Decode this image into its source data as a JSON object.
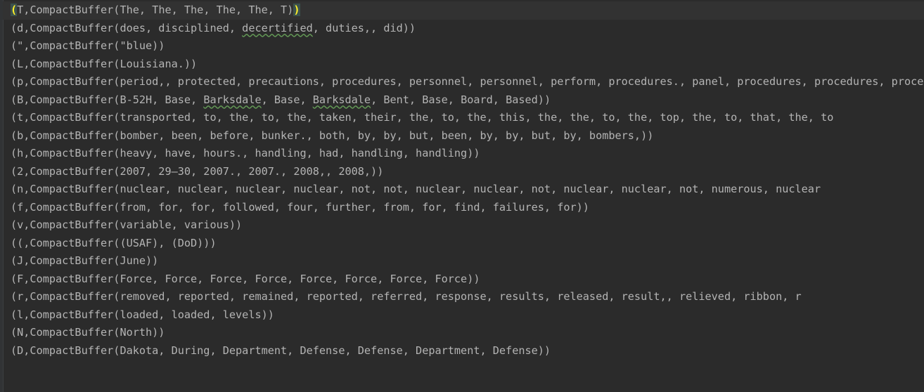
{
  "editor": {
    "status_icon": "checkmark-icon",
    "accent_color": "#629755",
    "lines": [
      {
        "pre": "",
        "open": "(",
        "body": "T,CompactBuffer(The, The, The, The, The, T)",
        "close": ")"
      },
      {
        "pre": "(d,CompactBuffer(does, disciplined, ",
        "sq": "decertified",
        "post": ", duties,, did))"
      },
      {
        "text": "(\",CompactBuffer(\"blue))"
      },
      {
        "text": "(L,CompactBuffer(Louisiana.))"
      },
      {
        "text": "(p,CompactBuffer(period,, protected, precautions, procedures, personnel, personnel, perform, procedures., panel, procedures, procedures, procedures"
      },
      {
        "pre": "(B,CompactBuffer(B-52H, Base, ",
        "sq": "Barksdale",
        "mid": ", Base, ",
        "sq2": "Barksdale",
        "post": ", Bent, Base, Board, Based))"
      },
      {
        "text": "(t,CompactBuffer(transported, to, the, to, the, taken, their, the, to, the, this, the, the, to, the, top, the, to, that, the, to"
      },
      {
        "text": "(b,CompactBuffer(bomber, been, before, bunker., both, by, by, but, been, by, by, but, by, bombers,))"
      },
      {
        "text": "(h,CompactBuffer(heavy, have, hours., handling, had, handling, handling))"
      },
      {
        "text": "(2,CompactBuffer(2007, 29–30, 2007., 2007., 2008,, 2008,))"
      },
      {
        "text": "(n,CompactBuffer(nuclear, nuclear, nuclear, nuclear, not, not, nuclear, nuclear, not, nuclear, nuclear, not, numerous, nuclear"
      },
      {
        "text": "(f,CompactBuffer(from, for, for, followed, four, further, from, for, find, failures, for))"
      },
      {
        "text": "(v,CompactBuffer(variable, various))"
      },
      {
        "text": "((,CompactBuffer((USAF), (DoD)))"
      },
      {
        "text": "(J,CompactBuffer(June))"
      },
      {
        "text": "(F,CompactBuffer(Force, Force, Force, Force, Force, Force, Force, Force))"
      },
      {
        "text": "(r,CompactBuffer(removed, reported, remained, reported, referred, response, results, released, result,, relieved, ribbon, r"
      },
      {
        "text": "(l,CompactBuffer(loaded, loaded, levels))"
      },
      {
        "text": "(N,CompactBuffer(North))"
      },
      {
        "text": "(D,CompactBuffer(Dakota, During, Department, Defense, Defense, Department, Defense))"
      }
    ]
  }
}
